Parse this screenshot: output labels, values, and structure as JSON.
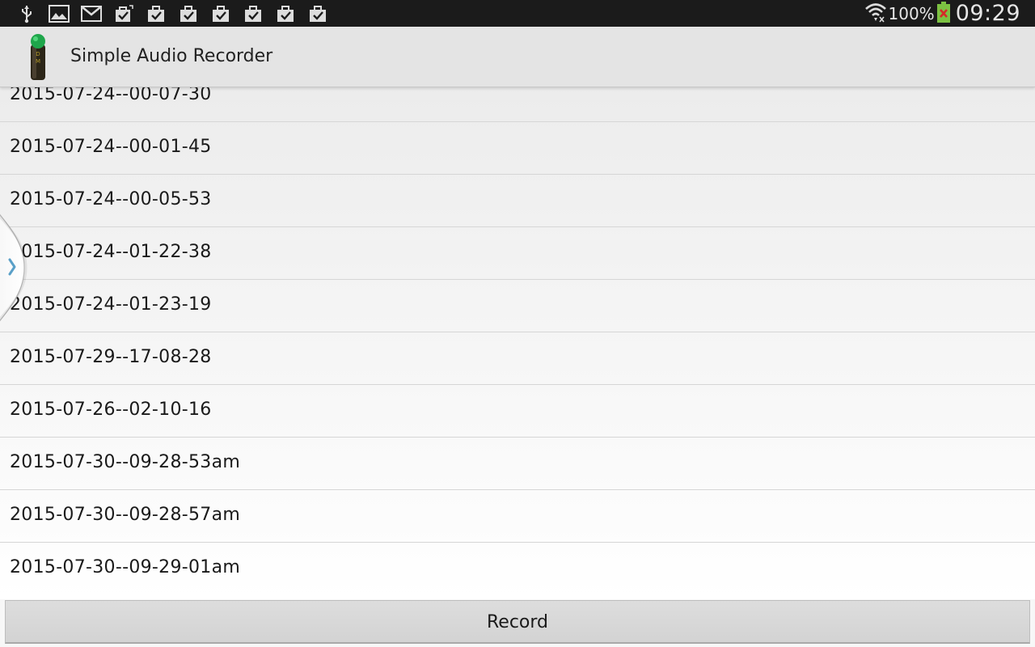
{
  "status_bar": {
    "left_icons": [
      "usb-icon",
      "gallery-icon",
      "gmail-icon",
      "store-update-icon",
      "store-check-icon",
      "store-check-icon",
      "store-check-icon",
      "store-check-icon",
      "store-check-icon",
      "store-check-icon"
    ],
    "battery_percent": "100%",
    "time": "09:29"
  },
  "action_bar": {
    "title": "Simple Audio Recorder",
    "app_icon_letters": [
      "D",
      "M"
    ]
  },
  "recordings": [
    "2015-07-24--00-07-30",
    "2015-07-24--00-01-45",
    "2015-07-24--00-05-53",
    "2015-07-24--01-22-38",
    "2015-07-24--01-23-19",
    "2015-07-29--17-08-28",
    "2015-07-26--02-10-16",
    "2015-07-30--09-28-53am",
    "2015-07-30--09-28-57am",
    "2015-07-30--09-29-01am"
  ],
  "record_button": {
    "label": "Record"
  },
  "colors": {
    "status_bar_bg": "#1b1b1b",
    "action_bar_bg": "#e4e4e4",
    "app_icon_green": "#1fa64b",
    "drawer_arrow": "#5aa0c8",
    "battery_green": "#7cc142",
    "battery_x": "#d62828"
  }
}
